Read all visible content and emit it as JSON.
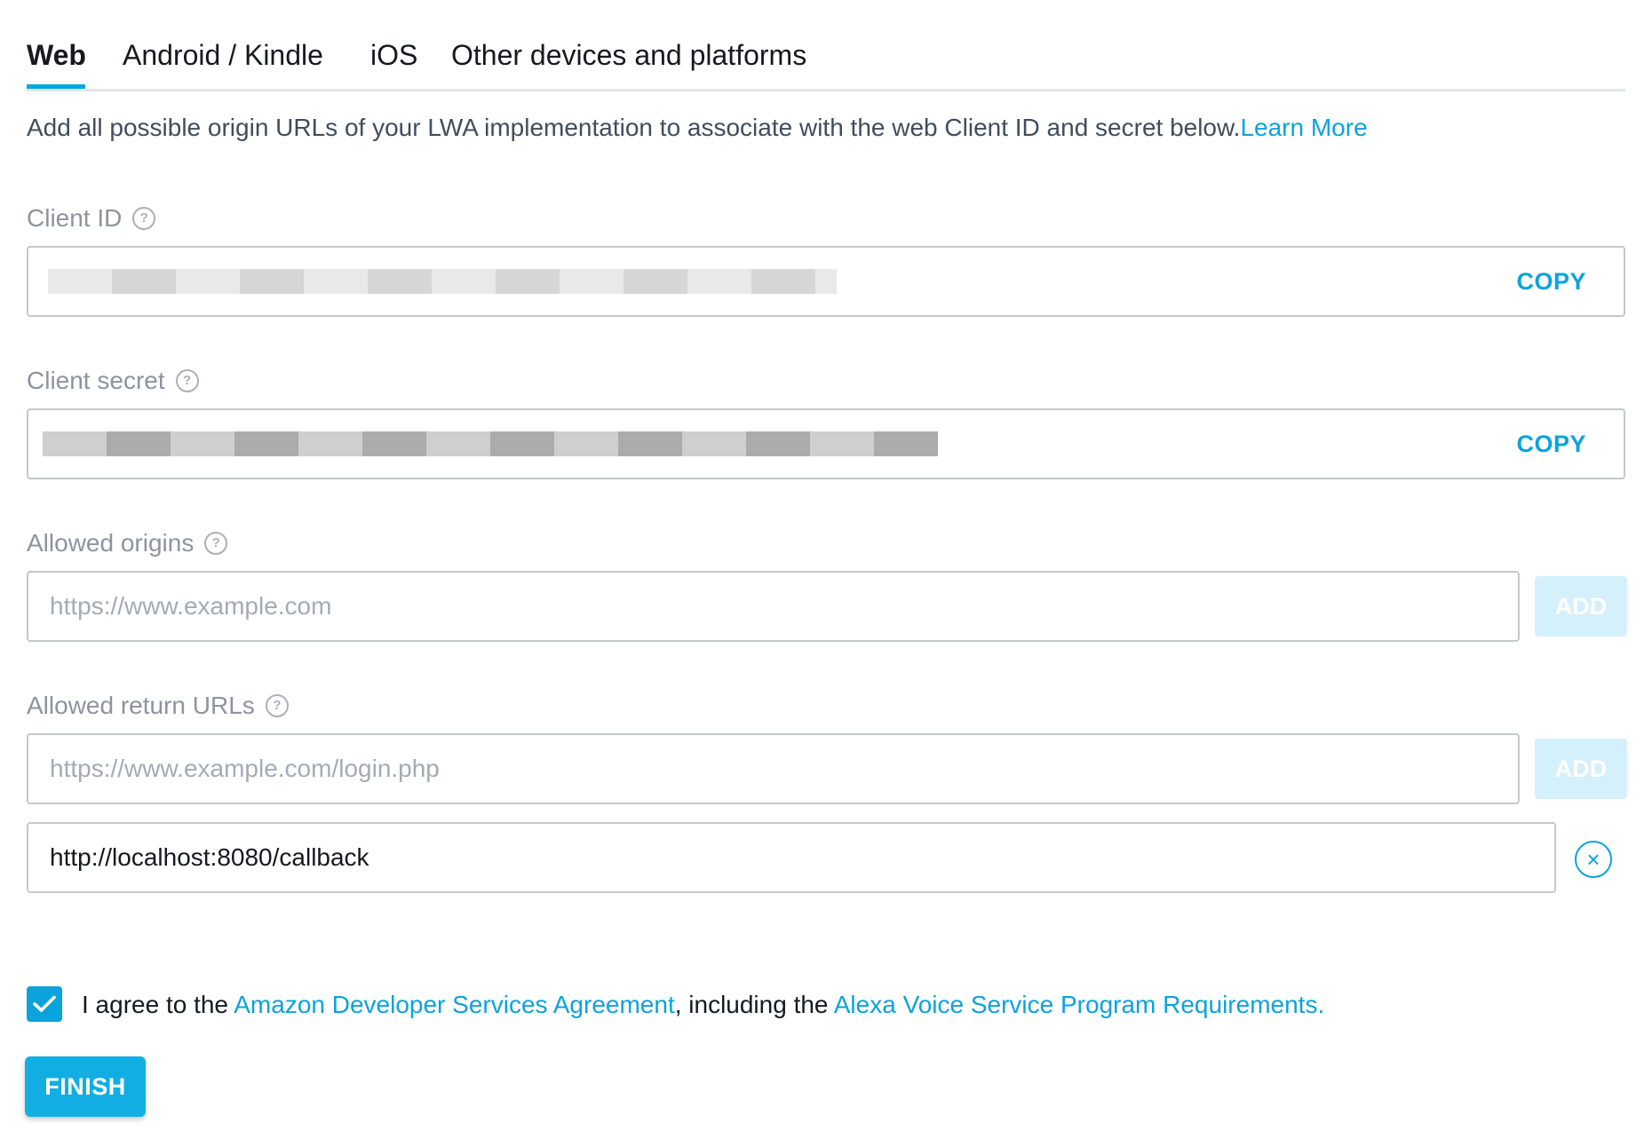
{
  "tabs": [
    {
      "label": "Web",
      "active": true
    },
    {
      "label": "Android / Kindle",
      "active": false
    },
    {
      "label": "iOS",
      "active": false
    },
    {
      "label": "Other devices and platforms",
      "active": false
    }
  ],
  "intro": {
    "text": "Add all possible origin URLs of your LWA implementation to associate with the web Client ID and secret below.",
    "link": "Learn More"
  },
  "client_id": {
    "label": "Client ID",
    "help_icon": "?",
    "copy_label": "COPY"
  },
  "client_secret": {
    "label": "Client secret",
    "help_icon": "?",
    "copy_label": "COPY"
  },
  "allowed_origins": {
    "label": "Allowed origins",
    "help_icon": "?",
    "placeholder": "https://www.example.com",
    "value": "",
    "add_label": "ADD"
  },
  "allowed_return_urls": {
    "label": "Allowed return URLs",
    "help_icon": "?",
    "placeholder": "https://www.example.com/login.php",
    "value": "",
    "add_label": "ADD",
    "entries": [
      "http://localhost:8080/callback"
    ],
    "remove_icon": "×"
  },
  "agreement": {
    "checked": true,
    "prefix": "I agree to the ",
    "link1": "Amazon Developer Services Agreement",
    "middle": ", including the ",
    "link2": "Alexa Voice Service Program Requirements."
  },
  "finish_label": "FINISH",
  "colors": {
    "accent": "#0ba3dc",
    "button_disabled": "#d4f0fb",
    "label_gray": "#8d949e",
    "border": "#c4c8cc"
  }
}
